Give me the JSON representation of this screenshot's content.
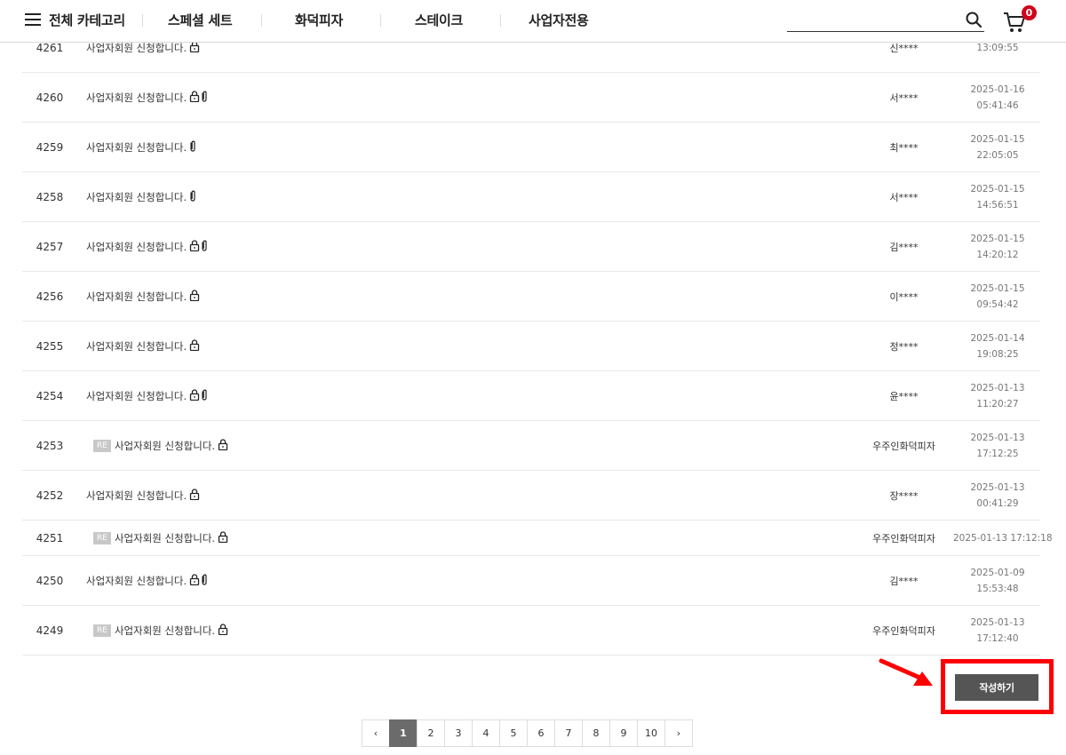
{
  "header": {
    "all_category": "전체 카테고리",
    "nav": [
      "스페셜 세트",
      "화덕피자",
      "스테이크",
      "사업자전용"
    ],
    "search_placeholder": "",
    "cart_count": "0"
  },
  "posts": [
    {
      "no": "4261",
      "title": "사업자회원 신청합니다.",
      "reply": false,
      "locked": true,
      "attach": false,
      "writer": "신****",
      "date": "",
      "time": "13:09:55"
    },
    {
      "no": "4260",
      "title": "사업자회원 신청합니다.",
      "reply": false,
      "locked": true,
      "attach": true,
      "writer": "서****",
      "date": "2025-01-16",
      "time": "05:41:46"
    },
    {
      "no": "4259",
      "title": "사업자회원 신청합니다.",
      "reply": false,
      "locked": false,
      "attach": true,
      "writer": "최****",
      "date": "2025-01-15",
      "time": "22:05:05"
    },
    {
      "no": "4258",
      "title": "사업자회원 신청합니다.",
      "reply": false,
      "locked": false,
      "attach": true,
      "writer": "서****",
      "date": "2025-01-15",
      "time": "14:56:51"
    },
    {
      "no": "4257",
      "title": "사업자회원 신청합니다.",
      "reply": false,
      "locked": true,
      "attach": true,
      "writer": "김****",
      "date": "2025-01-15",
      "time": "14:20:12"
    },
    {
      "no": "4256",
      "title": "사업자회원 신청합니다.",
      "reply": false,
      "locked": true,
      "attach": false,
      "writer": "이****",
      "date": "2025-01-15",
      "time": "09:54:42"
    },
    {
      "no": "4255",
      "title": "사업자회원 신청합니다.",
      "reply": false,
      "locked": true,
      "attach": false,
      "writer": "정****",
      "date": "2025-01-14",
      "time": "19:08:25"
    },
    {
      "no": "4254",
      "title": "사업자회원 신청합니다.",
      "reply": false,
      "locked": true,
      "attach": true,
      "writer": "윤****",
      "date": "2025-01-13",
      "time": "11:20:27"
    },
    {
      "no": "4253",
      "title": "사업자회원 신청합니다.",
      "reply": true,
      "locked": true,
      "attach": false,
      "writer": "우주인화덕피자",
      "date": "2025-01-13",
      "time": "17:12:25"
    },
    {
      "no": "4252",
      "title": "사업자회원 신청합니다.",
      "reply": false,
      "locked": true,
      "attach": false,
      "writer": "장****",
      "date": "2025-01-13",
      "time": "00:41:29"
    },
    {
      "no": "4251",
      "title": "사업자회원 신청합니다.",
      "reply": true,
      "locked": true,
      "attach": false,
      "writer": "우주인화덕피자",
      "date": "2025-01-13 17:12:18",
      "time": "",
      "oneline": true
    },
    {
      "no": "4250",
      "title": "사업자회원 신청합니다.",
      "reply": false,
      "locked": true,
      "attach": true,
      "writer": "김****",
      "date": "2025-01-09",
      "time": "15:53:48"
    },
    {
      "no": "4249",
      "title": "사업자회원 신청합니다.",
      "reply": true,
      "locked": true,
      "attach": false,
      "writer": "우주인화덕피자",
      "date": "2025-01-13",
      "time": "17:12:40"
    }
  ],
  "reply_badge": "RE",
  "write_button": "작성하기",
  "pagination": {
    "prev": "‹",
    "next": "›",
    "pages": [
      "1",
      "2",
      "3",
      "4",
      "5",
      "6",
      "7",
      "8",
      "9",
      "10"
    ],
    "current": "1"
  },
  "colors": {
    "accent_red": "#ff0000",
    "badge_red": "#d0021b",
    "button_dark": "#555555"
  }
}
